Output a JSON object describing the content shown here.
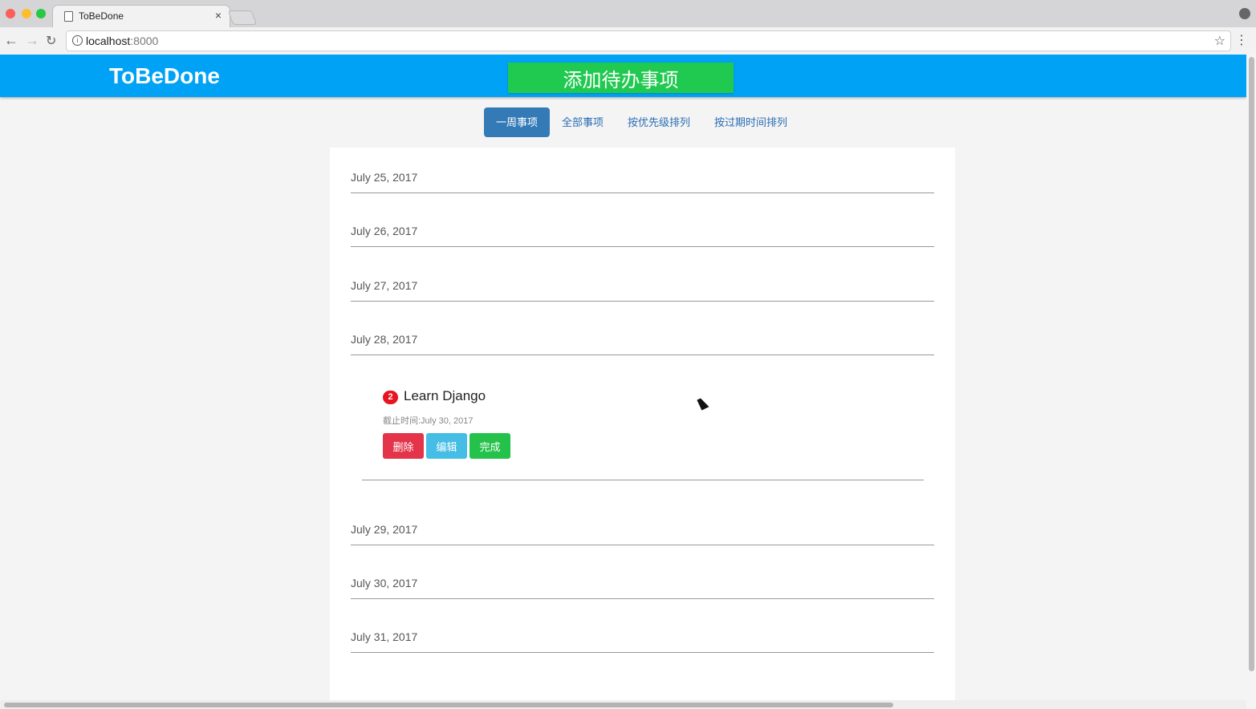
{
  "browser": {
    "tab_title": "ToBeDone",
    "tab_close": "×",
    "url_host": "localhost",
    "url_port": ":8000"
  },
  "navbar": {
    "brand": "ToBeDone",
    "add_button": "添加待办事项"
  },
  "tabs": [
    {
      "label": "一周事项",
      "active": true
    },
    {
      "label": "全部事项",
      "active": false
    },
    {
      "label": "按优先级排列",
      "active": false
    },
    {
      "label": "按过期时间排列",
      "active": false
    }
  ],
  "dates": [
    "July 25, 2017",
    "July 26, 2017",
    "July 27, 2017",
    "July 28, 2017",
    "July 29, 2017",
    "July 30, 2017",
    "July 31, 2017"
  ],
  "todo": {
    "priority": "2",
    "title": "Learn Django",
    "deadline": "截止时间:July 30, 2017",
    "actions": {
      "delete": "删除",
      "edit": "编辑",
      "done": "完成"
    }
  },
  "colors": {
    "navbar": "#00a2f5",
    "add_button": "#20c950",
    "active_tab": "#337ab7",
    "delete": "#e3344a",
    "edit": "#45bde5",
    "done": "#24c24a",
    "priority_badge": "#e8141f"
  }
}
